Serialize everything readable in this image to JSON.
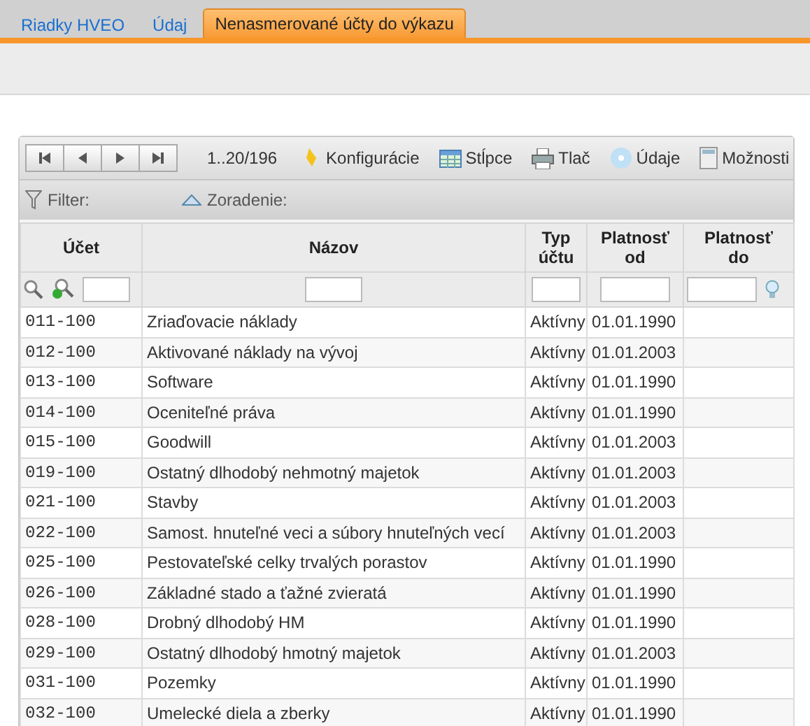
{
  "tabs": [
    {
      "label": "Riadky HVEO",
      "selected": false
    },
    {
      "label": "Údaj",
      "selected": false
    },
    {
      "label": "Nenasmerované účty do výkazu",
      "selected": true
    }
  ],
  "toolbar": {
    "range": "1..20/196",
    "actions": [
      {
        "label": "Konfigurácie",
        "kind": "config"
      },
      {
        "label": "Stĺpce",
        "kind": "columns"
      },
      {
        "label": "Tlač",
        "kind": "print"
      },
      {
        "label": "Údaje",
        "kind": "data"
      },
      {
        "label": "Možnosti",
        "kind": "options"
      }
    ]
  },
  "filter_bar": {
    "filter": "Filter:",
    "sort": "Zoradenie:"
  },
  "table": {
    "columns": [
      {
        "label": "Účet"
      },
      {
        "label": "Názov"
      },
      {
        "label": "Typ účtu"
      },
      {
        "label": "Platnosť od"
      },
      {
        "label": "Platnosť do"
      }
    ],
    "rows": [
      [
        "011-100",
        "Zriaďovacie náklady",
        "Aktívny",
        "01.01.1990"
      ],
      [
        "012-100",
        "Aktivované náklady na vývoj",
        "Aktívny",
        "01.01.2003"
      ],
      [
        "013-100",
        "Software",
        "Aktívny",
        "01.01.1990"
      ],
      [
        "014-100",
        "Oceniteľné práva",
        "Aktívny",
        "01.01.1990"
      ],
      [
        "015-100",
        "Goodwill",
        "Aktívny",
        "01.01.2003"
      ],
      [
        "019-100",
        "Ostatný dlhodobý nehmotný majetok",
        "Aktívny",
        "01.01.2003"
      ],
      [
        "021-100",
        "Stavby",
        "Aktívny",
        "01.01.2003"
      ],
      [
        "022-100",
        "Samost. hnuteľné veci a súbory hnuteľných vecí",
        "Aktívny",
        "01.01.2003"
      ],
      [
        "025-100",
        "Pestovateľské celky trvalých porastov",
        "Aktívny",
        "01.01.1990"
      ],
      [
        "026-100",
        "Základné stado a ťažné zvieratá",
        "Aktívny",
        "01.01.1990"
      ],
      [
        "028-100",
        "Drobný dlhodobý HM",
        "Aktívny",
        "01.01.1990"
      ],
      [
        "029-100",
        "Ostatný dlhodobý hmotný majetok",
        "Aktívny",
        "01.01.2003"
      ],
      [
        "031-100",
        "Pozemky",
        "Aktívny",
        "01.01.1990"
      ],
      [
        "032-100",
        "Umelecké diela a zberky",
        "Aktívny",
        "01.01.1990"
      ]
    ]
  }
}
